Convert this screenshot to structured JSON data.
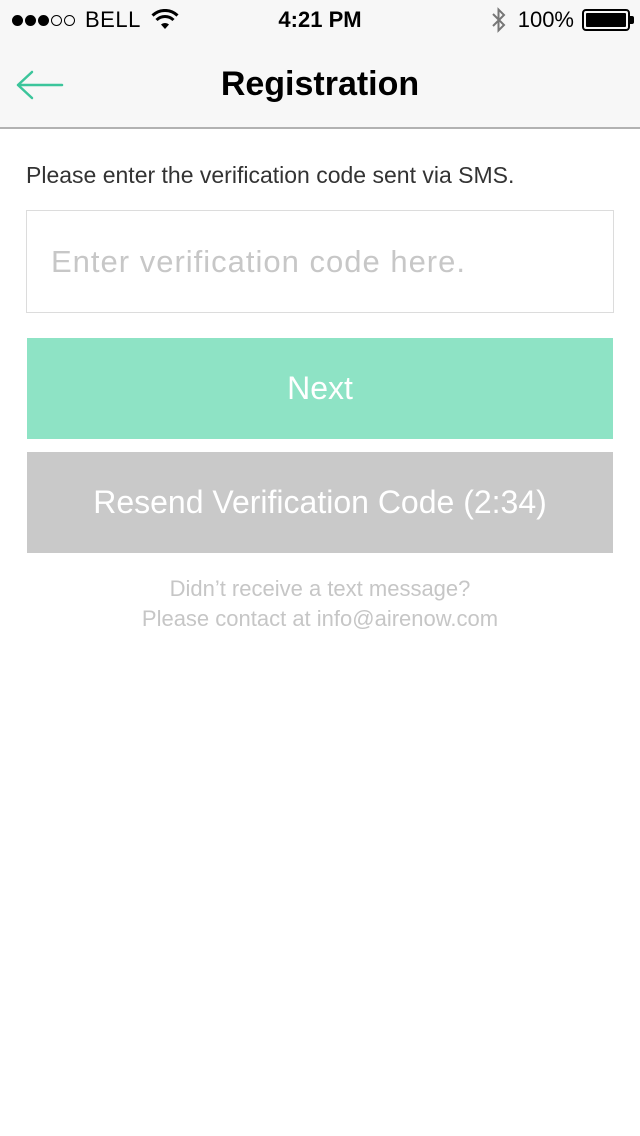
{
  "status_bar": {
    "carrier": "BELL",
    "time": "4:21 PM",
    "battery": "100%",
    "signal_full": 3,
    "signal_total": 5
  },
  "nav": {
    "title": "Registration",
    "back_icon": "arrow-left-icon",
    "accent": "#3cc59b"
  },
  "form": {
    "instruction": "Please enter the verification code sent via SMS.",
    "code_placeholder": "Enter verification code here.",
    "code_value": "",
    "next_label": "Next",
    "resend_label": "Resend Verification Code (2:34)"
  },
  "help": {
    "line1": "Didn’t receive a text message?",
    "line2": "Please contact at info@airenow.com"
  },
  "colors": {
    "next_button": "#8ee3c5",
    "resend_button": "#c9c9c9"
  }
}
